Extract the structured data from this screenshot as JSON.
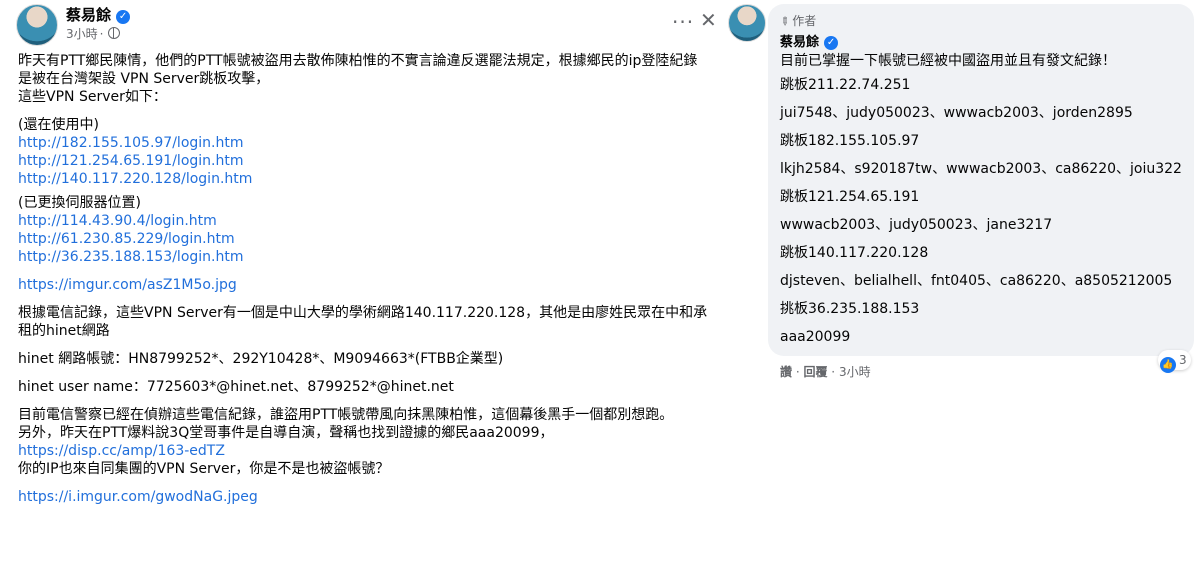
{
  "post": {
    "author": "蔡易餘",
    "time": "3小時",
    "more_label": "···",
    "close_label": "✕",
    "paragraph1": "昨天有PTT鄉民陳情，他們的PTT帳號被盜用去散佈陳柏惟的不實言論違反選罷法規定，根據鄉民的ip登陸紀錄是被在台灣架設 VPN Server跳板攻擊，",
    "paragraph1b": "這些VPN Server如下：",
    "in_use_label": "(還在使用中)",
    "in_use_links": [
      "http://182.155.105.97/login.htm",
      "http://121.254.65.191/login.htm",
      "http://140.117.220.128/login.htm"
    ],
    "moved_label": "(已更換伺服器位置)",
    "moved_links": [
      "http://114.43.90.4/login.htm",
      "http://61.230.85.229/login.htm",
      "http://36.235.188.153/login.htm"
    ],
    "imgur1": "https://imgur.com/asZ1M5o.jpg",
    "paragraph2": "根據電信記錄，這些VPN Server有一個是中山大學的學術網路140.117.220.128，其他是由廖姓民眾在中和承租的hinet網路",
    "paragraph3": "hinet 網路帳號：HN8799252*、292Y10428*、M9094663*(FTBB企業型)",
    "paragraph4": "hinet user name：7725603*@hinet.net、8799252*@hinet.net",
    "paragraph5": "目前電信警察已經在偵辦這些電信紀錄，誰盜用PTT帳號帶風向抹黑陳柏惟，這個幕後黑手一個都別想跑。",
    "paragraph6": "另外，昨天在PTT爆料說3Q堂哥事件是自導自演，聲稱也找到證據的鄉民aaa20099，",
    "disp_link": "https://disp.cc/amp/163-edTZ",
    "paragraph7": "你的IP也來自同集團的VPN Server，你是不是也被盜帳號？",
    "imgur2": "https://i.imgur.com/gwodNaG.jpeg"
  },
  "comment": {
    "author_tag": "作者",
    "author": "蔡易餘",
    "lines": [
      "目前已掌握一下帳號已經被中國盜用並且有發文紀錄！",
      "跳板211.22.74.251",
      "jui7548、judy050023、wwwacb2003、jorden2895",
      "跳板182.155.105.97",
      "lkjh2584、s920187tw、wwwacb2003、ca86220、joiu322",
      "跳板121.254.65.191",
      "wwwacb2003、judy050023、jane3217",
      "跳板140.117.220.128",
      "djsteven、belialhell、fnt0405、ca86220、a8505212005",
      "挑板36.235.188.153",
      "aaa20099"
    ],
    "reaction_count": "3",
    "like_action": "讚",
    "reply_action": "回覆",
    "separator": " · ",
    "time": "3小時"
  },
  "colors": {
    "link": "#216fdb",
    "verified": "#1877f2",
    "bubble": "#f0f2f5",
    "meta": "#65676b"
  }
}
